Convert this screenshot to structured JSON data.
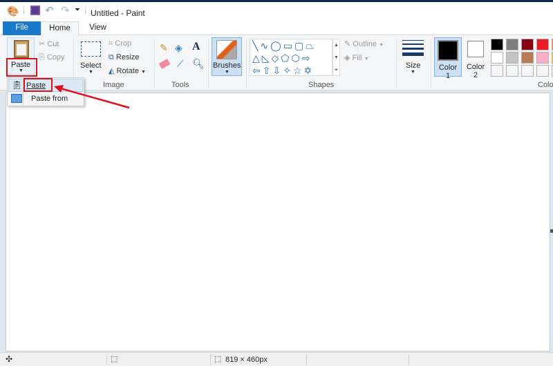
{
  "window": {
    "title": "Untitled - Paint"
  },
  "quick_access": [
    "save-icon",
    "undo-icon",
    "redo-icon",
    "customize-icon"
  ],
  "tabs": [
    {
      "label": "File"
    },
    {
      "label": "Home"
    },
    {
      "label": "View"
    }
  ],
  "clipboard": {
    "paste": "Paste",
    "cut": "Cut",
    "copy": "Copy"
  },
  "image": {
    "select": "Select",
    "crop": "Crop",
    "resize": "Resize",
    "rotate": "Rotate",
    "label": "Image"
  },
  "tools": {
    "label": "Tools"
  },
  "brushes": {
    "label": "Brushes"
  },
  "shapes": {
    "label": "Shapes",
    "outline": "Outline",
    "fill": "Fill"
  },
  "size": {
    "label": "Size"
  },
  "colors": {
    "color1": "Color",
    "color1_num": "1",
    "color2": "Color",
    "color2_num": "2",
    "label": "Colo",
    "palette": [
      "#000000",
      "#7f7f7f",
      "#880015",
      "#ed1c24",
      "#ff7f27",
      "#ffffff",
      "#c3c3c3",
      "#b97a57",
      "#ffaec9",
      "#ffc90e"
    ]
  },
  "paste_menu": {
    "items": [
      {
        "label": "Paste"
      },
      {
        "label": "Paste from"
      }
    ]
  },
  "status": {
    "canvas_size": "819 × 460px"
  },
  "accent": "#1979ca",
  "annotation_color": "#e0101a"
}
